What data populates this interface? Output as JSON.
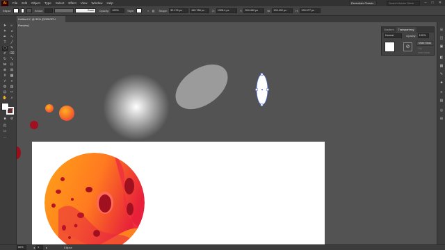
{
  "app": {
    "logo": "Ai"
  },
  "menu": [
    "File",
    "Edit",
    "Object",
    "Type",
    "Select",
    "Effect",
    "View",
    "Window",
    "Help"
  ],
  "workspace": "Essentials Classic",
  "search": {
    "placeholder": "Search Adobe Stock"
  },
  "window_controls": [
    "–",
    "□",
    "✕"
  ],
  "control_bar": {
    "selection": "Ellipse",
    "stroke_label": "Stroke:",
    "stroke_value": "",
    "brush_label": "Basic",
    "opacity_label": "Opacity:",
    "opacity_value": "100%",
    "style_label": "Style:",
    "shape_label": "Shape:",
    "w_value": "32.176 px",
    "h_value": "160.788 px",
    "x_label": "X:",
    "x_value": "1328.4 px",
    "y_label": "Y:",
    "y_value": "394.462 px",
    "w_label": "W:",
    "w2_value": "199.402 px",
    "h_label": "H:",
    "h2_value": "199.077 px"
  },
  "document_tab": "Untitled-1* @ 50% (RGB/GPU Preview)",
  "panel": {
    "tabs": [
      "Gradient",
      "Transparency"
    ],
    "blend_mode": "Normal",
    "opacity_label": "Opacity:",
    "opacity_value": "100%",
    "make_mask": "Make Mask",
    "clip": "Clip",
    "invert": "Invert Mask"
  },
  "status": {
    "zoom": "50%",
    "artboard": "1",
    "tool": "Ellipse"
  },
  "colors": {
    "planet_light": "#ffb020",
    "planet_dark": "#e8203a",
    "crater": "#a0101e"
  }
}
